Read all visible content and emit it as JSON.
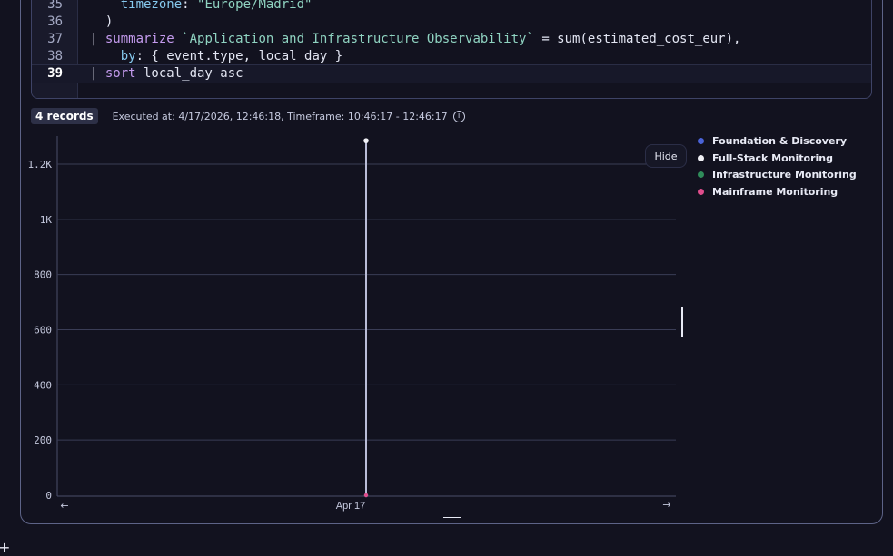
{
  "editor": {
    "lines": [
      {
        "num": "35",
        "tokens": [
          {
            "t": "    ",
            "c": "tok"
          },
          {
            "t": "timezone",
            "c": "prop"
          },
          {
            "t": ": ",
            "c": "tok"
          },
          {
            "t": "\"Europe/Madrid\"",
            "c": "str"
          }
        ]
      },
      {
        "num": "36",
        "tokens": [
          {
            "t": "  )",
            "c": "tok"
          }
        ]
      },
      {
        "num": "37",
        "tokens": [
          {
            "t": "| ",
            "c": "tok"
          },
          {
            "t": "summarize",
            "c": "kw"
          },
          {
            "t": " ",
            "c": "tok"
          },
          {
            "t": "`Application and Infrastructure Observability`",
            "c": "str"
          },
          {
            "t": " = sum(estimated_cost_eur),",
            "c": "tok"
          }
        ]
      },
      {
        "num": "38",
        "tokens": [
          {
            "t": "    ",
            "c": "tok"
          },
          {
            "t": "by",
            "c": "prop"
          },
          {
            "t": ": { event.type, local_day }",
            "c": "tok"
          }
        ]
      },
      {
        "num": "39",
        "tokens": [
          {
            "t": "| ",
            "c": "tok"
          },
          {
            "t": "sort",
            "c": "kw"
          },
          {
            "t": " local_day asc",
            "c": "tok"
          }
        ]
      }
    ]
  },
  "status": {
    "records": "4 records",
    "executed": "Executed at: 4/17/2026, 12:46:18, Timeframe: 10:46:17 - 12:46:17"
  },
  "legend": {
    "hide_label": "Hide",
    "items": [
      {
        "label": "Foundation & Discovery",
        "color": "#4a63d8"
      },
      {
        "label": "Full-Stack Monitoring",
        "color": "#f0f0f5"
      },
      {
        "label": "Infrastructure Monitoring",
        "color": "#2f8c5a"
      },
      {
        "label": "Mainframe Monitoring",
        "color": "#e04d8c"
      }
    ]
  },
  "chart_data": {
    "type": "line",
    "x": [
      "Apr 17"
    ],
    "ylim": [
      0,
      1300
    ],
    "yticks": [
      "0",
      "200",
      "400",
      "600",
      "800",
      "1K",
      "1.2K"
    ],
    "ytick_values": [
      0,
      200,
      400,
      600,
      800,
      1000,
      1200
    ],
    "series": [
      {
        "name": "Foundation & Discovery",
        "color": "#4a63d8",
        "values": [
          0
        ]
      },
      {
        "name": "Full-Stack Monitoring",
        "color": "#f0f0f5",
        "values": [
          1285
        ]
      },
      {
        "name": "Infrastructure Monitoring",
        "color": "#2f8c5a",
        "values": [
          0
        ]
      },
      {
        "name": "Mainframe Monitoring",
        "color": "#e04d8c",
        "values": [
          0
        ]
      }
    ],
    "grid": true,
    "legend_position": "right"
  }
}
